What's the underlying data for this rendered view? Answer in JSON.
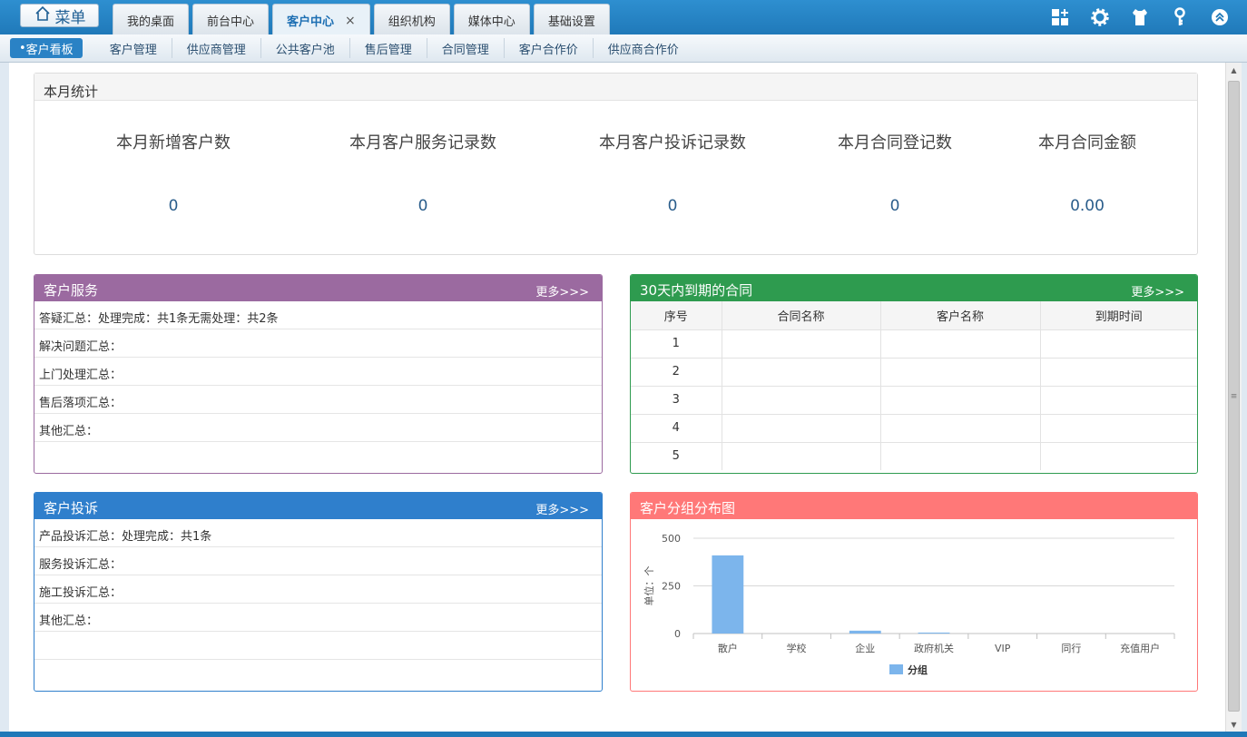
{
  "topbar": {
    "menu_label": "菜单",
    "tabs": [
      {
        "label": "我的桌面"
      },
      {
        "label": "前台中心"
      },
      {
        "label": "客户中心",
        "close": "×"
      },
      {
        "label": "组织机构"
      },
      {
        "label": "媒体中心"
      },
      {
        "label": "基础设置"
      }
    ],
    "icons": [
      "layout-icon",
      "gear-icon",
      "shirt-icon",
      "key-icon",
      "collapse-icon"
    ]
  },
  "subnav": {
    "items": [
      "客户看板",
      "客户管理",
      "供应商管理",
      "公共客户池",
      "售后管理",
      "合同管理",
      "客户合作价",
      "供应商合作价"
    ]
  },
  "monthly_stats": {
    "title": "本月统计",
    "items": [
      {
        "label": "本月新增客户数",
        "value": "0"
      },
      {
        "label": "本月客户服务记录数",
        "value": "0"
      },
      {
        "label": "本月客户投诉记录数",
        "value": "0"
      },
      {
        "label": "本月合同登记数",
        "value": "0"
      },
      {
        "label": "本月合同金额",
        "value": "0.00"
      }
    ]
  },
  "customer_service": {
    "title": "客户服务",
    "more": "更多>>>",
    "color": "#9b6aa0",
    "rows": [
      "答疑汇总：处理完成：共1条无需处理：共2条",
      "解决问题汇总：",
      "上门处理汇总：",
      "售后落项汇总：",
      "其他汇总：",
      ""
    ]
  },
  "expiring_contracts": {
    "title": "30天内到期的合同",
    "more": "更多>>>",
    "color": "#2e9b4f",
    "columns": [
      "序号",
      "合同名称",
      "客户名称",
      "到期时间"
    ],
    "rows": [
      [
        "1",
        "",
        "",
        ""
      ],
      [
        "2",
        "",
        "",
        ""
      ],
      [
        "3",
        "",
        "",
        ""
      ],
      [
        "4",
        "",
        "",
        ""
      ],
      [
        "5",
        "",
        "",
        ""
      ]
    ]
  },
  "customer_complaints": {
    "title": "客户投诉",
    "more": "更多>>>",
    "color": "#2f7fcc",
    "rows": [
      "产品投诉汇总：处理完成：共1条",
      "服务投诉汇总：",
      "施工投诉汇总：",
      "其他汇总：",
      "",
      ""
    ]
  },
  "group_chart": {
    "title": "客户分组分布图",
    "color": "#ff7878"
  },
  "chart_data": {
    "type": "bar",
    "categories": [
      "散户",
      "学校",
      "企业",
      "政府机关",
      "VIP",
      "同行",
      "充值用户"
    ],
    "series": [
      {
        "name": "分组",
        "values": [
          410,
          0,
          15,
          5,
          0,
          0,
          0
        ]
      }
    ],
    "ylabel": "单位：个",
    "ylim": [
      0,
      500
    ],
    "yticks": [
      "0",
      "250",
      "500"
    ],
    "bar_color": "#7cb5ec",
    "grid": true,
    "legend_position": "bottom"
  }
}
